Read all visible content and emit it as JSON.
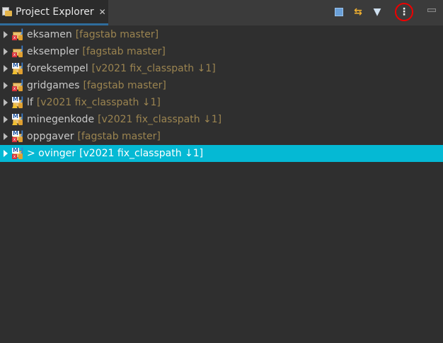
{
  "tab": {
    "title": "Project Explorer",
    "close_icon": "close-icon"
  },
  "toolbar": {
    "collapse_all": "collapse-all-icon",
    "link_editor": "link-with-editor-icon",
    "filter": "filter-icon",
    "menu": "⋮",
    "minimize": "minimize-icon"
  },
  "projects": [
    {
      "name": "eksamen",
      "decoration": "[fagstab master]",
      "marker": "error",
      "maven": false,
      "selected": false
    },
    {
      "name": "eksempler",
      "decoration": "[fagstab master]",
      "marker": "error",
      "maven": false,
      "selected": false
    },
    {
      "name": "foreksempel",
      "decoration": "[v2021 fix_classpath ↓1]",
      "marker": "warning",
      "maven": true,
      "selected": false
    },
    {
      "name": "gridgames",
      "decoration": "[fagstab master]",
      "marker": "error",
      "maven": false,
      "selected": false
    },
    {
      "name": "lf",
      "decoration": "[v2021 fix_classpath ↓1]",
      "marker": "warning",
      "maven": true,
      "selected": false
    },
    {
      "name": "minegenkode",
      "decoration": "[v2021 fix_classpath ↓1]",
      "marker": "warning",
      "maven": true,
      "selected": false
    },
    {
      "name": "oppgaver",
      "decoration": "[fagstab master]",
      "marker": "error",
      "maven": true,
      "selected": false
    },
    {
      "name": "> ovinger",
      "decoration": "[v2021 fix_classpath ↓1]",
      "marker": "error",
      "maven": true,
      "selected": true
    }
  ],
  "colors": {
    "selection": "#05b9d4",
    "decoration": "#9b8450",
    "tab_underline": "#2f6d9c"
  }
}
